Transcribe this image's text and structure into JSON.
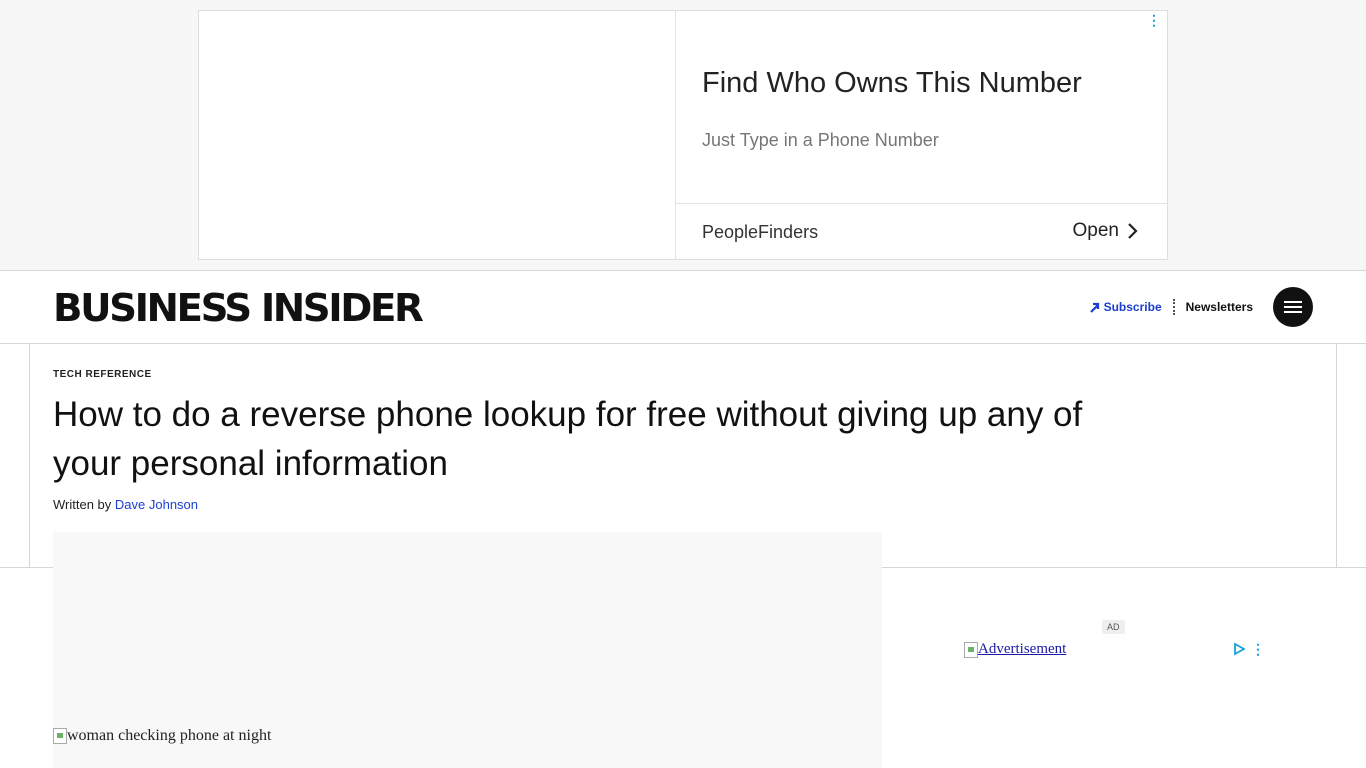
{
  "top_ad": {
    "headline": "Find Who Owns This Number",
    "subline": "Just Type in a Phone Number",
    "advertiser": "PeopleFinders",
    "cta": "Open",
    "menu_icon": "⋮"
  },
  "header": {
    "logo": "BUSINESS INSIDER",
    "subscribe": "Subscribe",
    "newsletters": "Newsletters"
  },
  "article": {
    "category": "TECH REFERENCE",
    "headline": "How to do a reverse phone lookup for free without giving up any of your personal information",
    "byline_prefix": "Written by",
    "author": "Dave Johnson",
    "hero_alt": "woman checking phone at night"
  },
  "side_ad": {
    "badge": "AD",
    "link_text": "Advertisement",
    "menu_icon": "⋮"
  },
  "colors": {
    "link_blue": "#1a3fd1",
    "ad_icon_cyan": "#1aa0d8"
  }
}
